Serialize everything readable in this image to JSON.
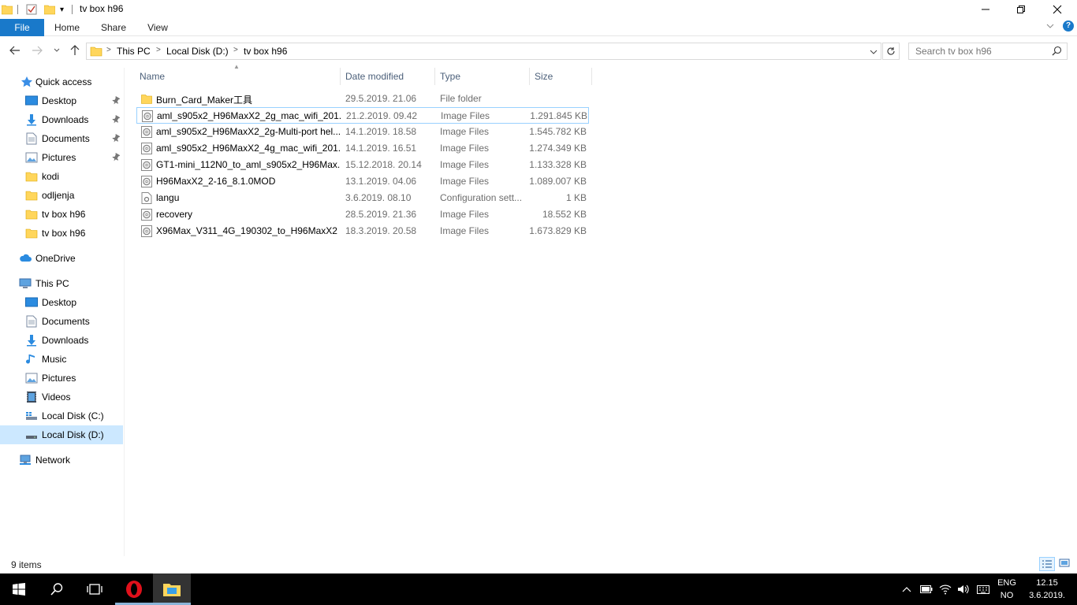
{
  "window": {
    "title": "tv box h96",
    "quick_access_dropdown": "▾"
  },
  "ribbon": {
    "tabs": [
      {
        "label": "File"
      },
      {
        "label": "Home"
      },
      {
        "label": "Share"
      },
      {
        "label": "View"
      }
    ]
  },
  "address": {
    "crumbs": [
      "This PC",
      "Local Disk (D:)",
      "tv box h96"
    ]
  },
  "search": {
    "placeholder": "Search tv box h96"
  },
  "nav": {
    "quick_access": "Quick access",
    "quick_items": [
      {
        "label": "Desktop",
        "icon": "desktop-icon",
        "pinned": true
      },
      {
        "label": "Downloads",
        "icon": "downloads-icon",
        "pinned": true
      },
      {
        "label": "Documents",
        "icon": "documents-icon",
        "pinned": true
      },
      {
        "label": "Pictures",
        "icon": "pictures-icon",
        "pinned": true
      },
      {
        "label": "kodi",
        "icon": "folder-icon",
        "pinned": false
      },
      {
        "label": "odljenja",
        "icon": "folder-icon",
        "pinned": false
      },
      {
        "label": "tv box h96",
        "icon": "folder-icon",
        "pinned": false
      },
      {
        "label": "tv box h96",
        "icon": "folder-icon",
        "pinned": false
      }
    ],
    "onedrive": "OneDrive",
    "this_pc": "This PC",
    "pc_items": [
      {
        "label": "Desktop",
        "icon": "desktop-icon"
      },
      {
        "label": "Documents",
        "icon": "documents-icon"
      },
      {
        "label": "Downloads",
        "icon": "downloads-icon"
      },
      {
        "label": "Music",
        "icon": "music-icon"
      },
      {
        "label": "Pictures",
        "icon": "pictures-icon"
      },
      {
        "label": "Videos",
        "icon": "videos-icon"
      },
      {
        "label": "Local Disk (C:)",
        "icon": "drive-c-icon"
      },
      {
        "label": "Local Disk (D:)",
        "icon": "drive-d-icon",
        "selected": true
      }
    ],
    "network": "Network"
  },
  "columns": {
    "name": "Name",
    "date": "Date modified",
    "type": "Type",
    "size": "Size"
  },
  "files": [
    {
      "name": "Burn_Card_Maker工具",
      "date": "29.5.2019. 21.06",
      "type": "File folder",
      "size": "",
      "icon": "folder-icon"
    },
    {
      "name": "aml_s905x2_H96MaxX2_2g_mac_wifi_201...",
      "date": "21.2.2019. 09.42",
      "type": "Image Files",
      "size": "1.291.845 KB",
      "icon": "disc-image-icon",
      "selected": true
    },
    {
      "name": "aml_s905x2_H96MaxX2_2g-Multi-port hel...",
      "date": "14.1.2019. 18.58",
      "type": "Image Files",
      "size": "1.545.782 KB",
      "icon": "disc-image-icon"
    },
    {
      "name": "aml_s905x2_H96MaxX2_4g_mac_wifi_201...",
      "date": "14.1.2019. 16.51",
      "type": "Image Files",
      "size": "1.274.349 KB",
      "icon": "disc-image-icon"
    },
    {
      "name": "GT1-mini_112N0_to_aml_s905x2_H96Max...",
      "date": "15.12.2018. 20.14",
      "type": "Image Files",
      "size": "1.133.328 KB",
      "icon": "disc-image-icon"
    },
    {
      "name": "H96MaxX2_2-16_8.1.0MOD",
      "date": "13.1.2019. 04.06",
      "type": "Image Files",
      "size": "1.089.007 KB",
      "icon": "disc-image-icon"
    },
    {
      "name": "langu",
      "date": "3.6.2019. 08.10",
      "type": "Configuration sett...",
      "size": "1 KB",
      "icon": "config-file-icon"
    },
    {
      "name": "recovery",
      "date": "28.5.2019. 21.36",
      "type": "Image Files",
      "size": "18.552 KB",
      "icon": "disc-image-icon"
    },
    {
      "name": "X96Max_V311_4G_190302_to_H96MaxX2",
      "date": "18.3.2019. 20.58",
      "type": "Image Files",
      "size": "1.673.829 KB",
      "icon": "disc-image-icon"
    }
  ],
  "status": {
    "item_count": "9 items"
  },
  "taskbar": {
    "lang_line1": "ENG",
    "lang_line2": "NO",
    "time": "12.15",
    "date": "3.6.2019."
  },
  "colors": {
    "accent": "#1979ca",
    "selection": "#cce8ff",
    "selection_border": "#99d1ff",
    "folder": "#ffd65c",
    "taskbar": "#000000"
  }
}
